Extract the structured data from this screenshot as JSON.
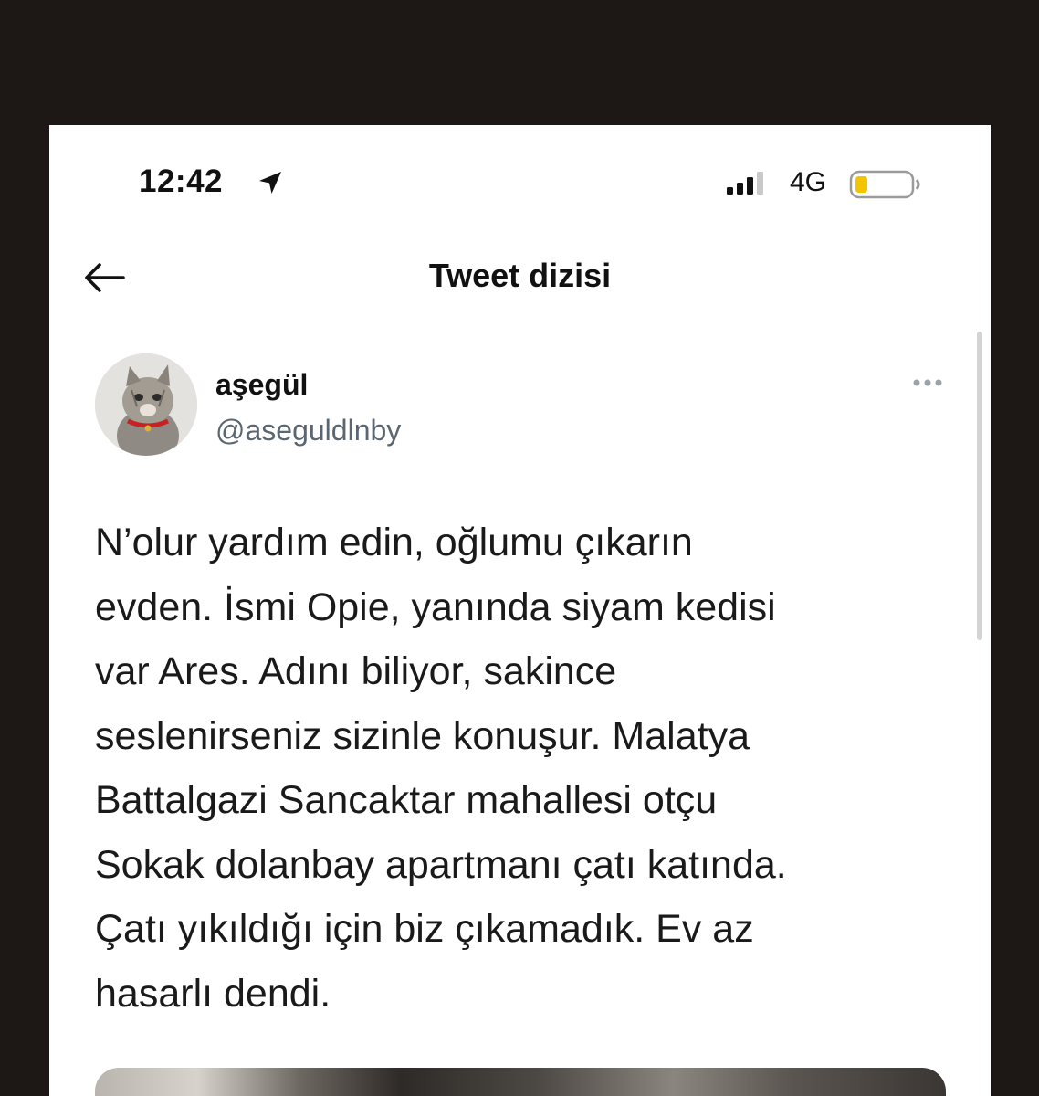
{
  "status_bar": {
    "time": "12:42",
    "network": "4G",
    "icons": [
      "location-arrow-icon",
      "cellular-signal-icon",
      "battery-low-icon"
    ]
  },
  "nav": {
    "title": "Tweet dizisi",
    "back_icon": "back-arrow-icon"
  },
  "tweet": {
    "author_name": "aşegül",
    "author_handle": "@aseguldlnby",
    "avatar_icon": "cat-avatar",
    "more_icon": "more-options-icon",
    "text": "N’olur yardım edin, oğlumu çıkarın\nevden. İsmi Opie, yanında siyam kedisi\nvar Ares. Adını biliyor, sakince\nseslenirseniz sizinle konuşur. Malatya\nBattalgazi Sancaktar mahallesi otçu\nSokak dolanbay apartmanı çatı katında.\nÇatı yıkıldığı için biz çıkamadık. Ev az\nhasarlı dendi."
  },
  "colors": {
    "background": "#1d1716",
    "screen": "#ffffff",
    "text": "#111111",
    "handle": "#5b6670",
    "battery_fill": "#f2c500"
  }
}
